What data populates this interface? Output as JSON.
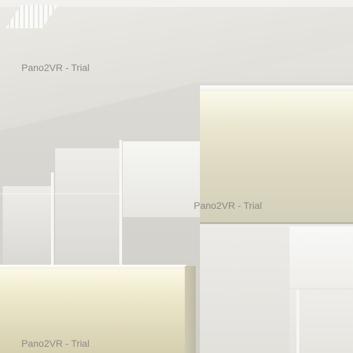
{
  "viewer": {
    "watermarks": [
      "Pano2VR - Trial",
      "Pano2VR - Trial",
      "Pano2VR - Trial"
    ]
  },
  "scene": {
    "description_colors": {
      "ceiling": "#f2f1ee",
      "wall": "#d6d5cf",
      "counter_glow": "#ebe7d1"
    }
  }
}
